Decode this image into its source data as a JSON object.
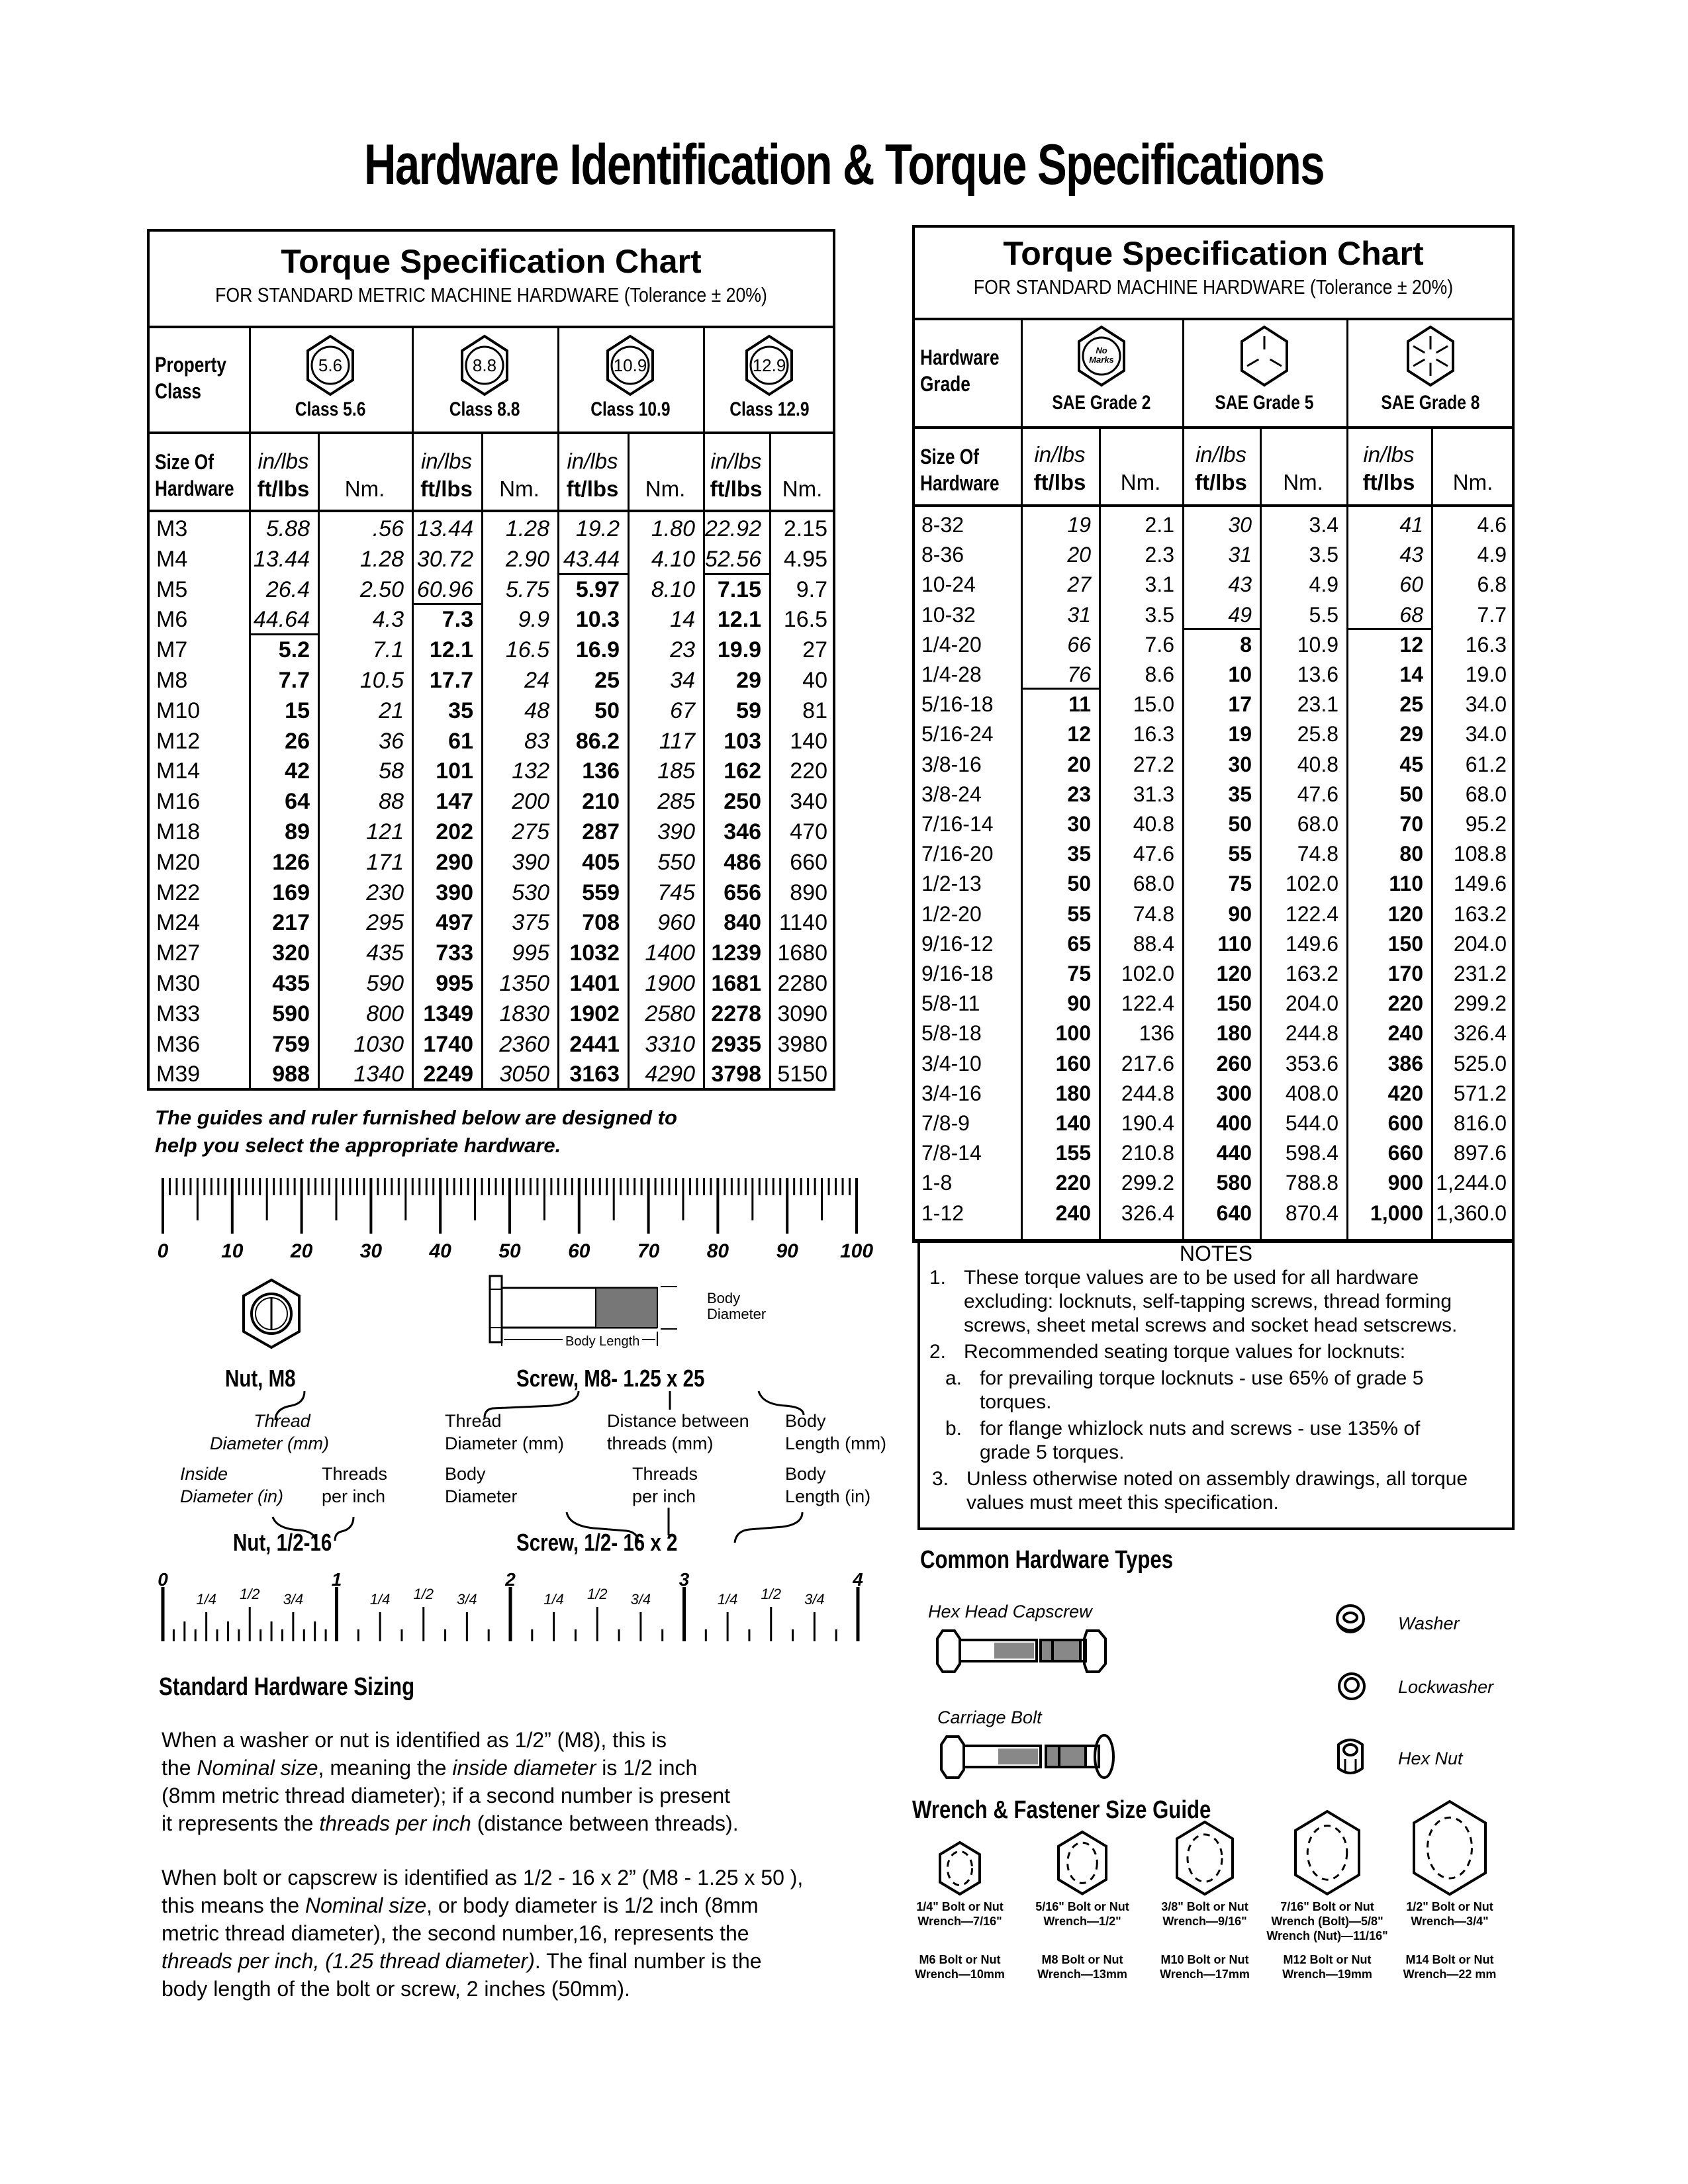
{
  "page_title": "Hardware Identification  &  Torque Specifications",
  "metric_chart": {
    "title": "Torque Specification Chart",
    "subtitle": "FOR STANDARD METRIC MACHINE HARDWARE (Tolerance ± 20%)",
    "property_class_label_1": "Property",
    "property_class_label_2": "Class",
    "classes": [
      {
        "mark": "5.6",
        "label": "Class 5.6"
      },
      {
        "mark": "8.8",
        "label": "Class 8.8"
      },
      {
        "mark": "10.9",
        "label": "Class 10.9"
      },
      {
        "mark": "12.9",
        "label": "Class 12.9"
      }
    ],
    "size_label_1": "Size Of",
    "size_label_2": "Hardware",
    "unit_top": "in/lbs",
    "unit_bottom": "ft/lbs",
    "unit_nm": "Nm.",
    "rows": [
      {
        "size": "M3",
        "v": [
          "5.88",
          ".56",
          "13.44",
          "1.28",
          "19.2",
          "1.80",
          "22.92",
          "2.15"
        ]
      },
      {
        "size": "M4",
        "v": [
          "13.44",
          "1.28",
          "30.72",
          "2.90",
          "43.44",
          "4.10",
          "52.56",
          "4.95"
        ]
      },
      {
        "size": "M5",
        "v": [
          "26.4",
          "2.50",
          "60.96",
          "5.75",
          "5.97",
          "8.10",
          "7.15",
          "9.7"
        ]
      },
      {
        "size": "M6",
        "v": [
          "44.64",
          "4.3",
          "7.3",
          "9.9",
          "10.3",
          "14",
          "12.1",
          "16.5"
        ]
      },
      {
        "size": "M7",
        "v": [
          "5.2",
          "7.1",
          "12.1",
          "16.5",
          "16.9",
          "23",
          "19.9",
          "27"
        ]
      },
      {
        "size": "M8",
        "v": [
          "7.7",
          "10.5",
          "17.7",
          "24",
          "25",
          "34",
          "29",
          "40"
        ]
      },
      {
        "size": "M10",
        "v": [
          "15",
          "21",
          "35",
          "48",
          "50",
          "67",
          "59",
          "81"
        ]
      },
      {
        "size": "M12",
        "v": [
          "26",
          "36",
          "61",
          "83",
          "86.2",
          "117",
          "103",
          "140"
        ]
      },
      {
        "size": "M14",
        "v": [
          "42",
          "58",
          "101",
          "132",
          "136",
          "185",
          "162",
          "220"
        ]
      },
      {
        "size": "M16",
        "v": [
          "64",
          "88",
          "147",
          "200",
          "210",
          "285",
          "250",
          "340"
        ]
      },
      {
        "size": "M18",
        "v": [
          "89",
          "121",
          "202",
          "275",
          "287",
          "390",
          "346",
          "470"
        ]
      },
      {
        "size": "M20",
        "v": [
          "126",
          "171",
          "290",
          "390",
          "405",
          "550",
          "486",
          "660"
        ]
      },
      {
        "size": "M22",
        "v": [
          "169",
          "230",
          "390",
          "530",
          "559",
          "745",
          "656",
          "890"
        ]
      },
      {
        "size": "M24",
        "v": [
          "217",
          "295",
          "497",
          "375",
          "708",
          "960",
          "840",
          "1140"
        ]
      },
      {
        "size": "M27",
        "v": [
          "320",
          "435",
          "733",
          "995",
          "1032",
          "1400",
          "1239",
          "1680"
        ]
      },
      {
        "size": "M30",
        "v": [
          "435",
          "590",
          "995",
          "1350",
          "1401",
          "1900",
          "1681",
          "2280"
        ]
      },
      {
        "size": "M33",
        "v": [
          "590",
          "800",
          "1349",
          "1830",
          "1902",
          "2580",
          "2278",
          "3090"
        ]
      },
      {
        "size": "M36",
        "v": [
          "759",
          "1030",
          "1740",
          "2360",
          "2441",
          "3310",
          "2935",
          "3980"
        ]
      },
      {
        "size": "M39",
        "v": [
          "988",
          "1340",
          "2249",
          "3050",
          "3163",
          "4290",
          "3798",
          "5150"
        ]
      }
    ],
    "inlbs_rows_through": [
      3,
      2,
      1,
      1
    ]
  },
  "guide_note_1": "The guides and ruler furnished below are designed to",
  "guide_note_2": "help you select the appropriate hardware.",
  "mm_ruler": {
    "labels": [
      "0",
      "10",
      "20",
      "30",
      "40",
      "50",
      "60",
      "70",
      "80",
      "90",
      "100"
    ],
    "unit": "mm",
    "max": 100
  },
  "metric_nut": {
    "name": "Nut, M8",
    "thread_label_1": "Thread",
    "thread_label_2": "Diameter (mm)"
  },
  "metric_screw": {
    "name": "Screw, M8- 1.25 x 25",
    "body_diameter_1": "Body",
    "body_diameter_2": "Diameter",
    "body_length": "Body Length",
    "lbl_thread_1": "Thread",
    "lbl_thread_2": "Diameter (mm)",
    "lbl_dist_1": "Distance between",
    "lbl_dist_2": "threads (mm)",
    "lbl_len_1": "Body",
    "lbl_len_2": "Length (mm)"
  },
  "inch_nut": {
    "name": "Nut, 1/2-16",
    "lbl_inside_1": "Inside",
    "lbl_inside_2": "Diameter (in)",
    "lbl_threads_1": "Threads",
    "lbl_threads_2": "per inch"
  },
  "inch_screw": {
    "name": "Screw, 1/2- 16 x 2",
    "lbl_body_1": "Body",
    "lbl_body_2": "Diameter",
    "lbl_threads_1": "Threads",
    "lbl_threads_2": "per inch",
    "lbl_len_1": "Body",
    "lbl_len_2": "Length (in)"
  },
  "inch_ruler": {
    "whole_labels": [
      "0",
      "1",
      "2",
      "3",
      "4"
    ],
    "fraction_labels": [
      "1/4",
      "1/2",
      "3/4"
    ],
    "unit": "in",
    "max": 4
  },
  "sizing": {
    "title": "Standard Hardware Sizing",
    "p1": [
      {
        "t": "When a washer or nut is identified as 1/2” (M8), this is"
      },
      {
        "t": "the ",
        "i": "Nominal size",
        "t2": ", meaning the ",
        "i2": "inside diameter",
        "t3": " is 1/2 inch"
      },
      {
        "t": "(8mm metric thread diameter); if a second number is present"
      },
      {
        "t": "it represents the ",
        "i": "threads per inch",
        "t2": " (distance between threads)."
      }
    ],
    "p2": [
      {
        "t": "When bolt or capscrew is identified as 1/2 - 16 x 2” (M8 - 1.25 x 50 ),"
      },
      {
        "t": "this means the ",
        "i": "Nominal size",
        "t2": ", or body diameter is 1/2 inch (8mm"
      },
      {
        "t": "metric thread diameter), the second number,16, represents the"
      },
      {
        "i": "threads per inch, (1.25 thread diameter)",
        "t2": ". The final number is the"
      },
      {
        "t": "body length of the bolt or screw, 2 inches (50mm)."
      }
    ]
  },
  "sae_chart": {
    "title": "Torque Specification Chart",
    "subtitle": "FOR STANDARD MACHINE HARDWARE (Tolerance ± 20%)",
    "grade_label_1": "Hardware",
    "grade_label_2": "Grade",
    "grades": [
      {
        "mark": "No Marks",
        "label": "SAE Grade 2"
      },
      {
        "mark": "3 radial lines",
        "label": "SAE Grade 5"
      },
      {
        "mark": "6 radial lines",
        "label": "SAE Grade 8"
      }
    ],
    "size_label_1": "Size Of",
    "size_label_2": "Hardware",
    "unit_top": "in/lbs",
    "unit_bottom": "ft/lbs",
    "unit_nm": "Nm.",
    "rows": [
      {
        "size": "8-32",
        "v": [
          "19",
          "2.1",
          "30",
          "3.4",
          "41",
          "4.6"
        ]
      },
      {
        "size": "8-36",
        "v": [
          "20",
          "2.3",
          "31",
          "3.5",
          "43",
          "4.9"
        ]
      },
      {
        "size": "10-24",
        "v": [
          "27",
          "3.1",
          "43",
          "4.9",
          "60",
          "6.8"
        ]
      },
      {
        "size": "10-32",
        "v": [
          "31",
          "3.5",
          "49",
          "5.5",
          "68",
          "7.7"
        ]
      },
      {
        "size": "1/4-20",
        "v": [
          "66",
          "7.6",
          "8",
          "10.9",
          "12",
          "16.3"
        ]
      },
      {
        "size": "1/4-28",
        "v": [
          "76",
          "8.6",
          "10",
          "13.6",
          "14",
          "19.0"
        ]
      },
      {
        "size": "5/16-18",
        "v": [
          "11",
          "15.0",
          "17",
          "23.1",
          "25",
          "34.0"
        ]
      },
      {
        "size": "5/16-24",
        "v": [
          "12",
          "16.3",
          "19",
          "25.8",
          "29",
          "34.0"
        ]
      },
      {
        "size": "3/8-16",
        "v": [
          "20",
          "27.2",
          "30",
          "40.8",
          "45",
          "61.2"
        ]
      },
      {
        "size": "3/8-24",
        "v": [
          "23",
          "31.3",
          "35",
          "47.6",
          "50",
          "68.0"
        ]
      },
      {
        "size": "7/16-14",
        "v": [
          "30",
          "40.8",
          "50",
          "68.0",
          "70",
          "95.2"
        ]
      },
      {
        "size": "7/16-20",
        "v": [
          "35",
          "47.6",
          "55",
          "74.8",
          "80",
          "108.8"
        ]
      },
      {
        "size": "1/2-13",
        "v": [
          "50",
          "68.0",
          "75",
          "102.0",
          "110",
          "149.6"
        ]
      },
      {
        "size": "1/2-20",
        "v": [
          "55",
          "74.8",
          "90",
          "122.4",
          "120",
          "163.2"
        ]
      },
      {
        "size": "9/16-12",
        "v": [
          "65",
          "88.4",
          "110",
          "149.6",
          "150",
          "204.0"
        ]
      },
      {
        "size": "9/16-18",
        "v": [
          "75",
          "102.0",
          "120",
          "163.2",
          "170",
          "231.2"
        ]
      },
      {
        "size": "5/8-11",
        "v": [
          "90",
          "122.4",
          "150",
          "204.0",
          "220",
          "299.2"
        ]
      },
      {
        "size": "5/8-18",
        "v": [
          "100",
          "136",
          "180",
          "244.8",
          "240",
          "326.4"
        ]
      },
      {
        "size": "3/4-10",
        "v": [
          "160",
          "217.6",
          "260",
          "353.6",
          "386",
          "525.0"
        ]
      },
      {
        "size": "3/4-16",
        "v": [
          "180",
          "244.8",
          "300",
          "408.0",
          "420",
          "571.2"
        ]
      },
      {
        "size": "7/8-9",
        "v": [
          "140",
          "190.4",
          "400",
          "544.0",
          "600",
          "816.0"
        ]
      },
      {
        "size": "7/8-14",
        "v": [
          "155",
          "210.8",
          "440",
          "598.4",
          "660",
          "897.6"
        ]
      },
      {
        "size": "1-8",
        "v": [
          "220",
          "299.2",
          "580",
          "788.8",
          "900",
          "1,244.0"
        ]
      },
      {
        "size": "1-12",
        "v": [
          "240",
          "326.4",
          "640",
          "870.4",
          "1,000",
          "1,360.0"
        ]
      }
    ],
    "inlbs_rows_through": [
      5,
      3,
      3
    ]
  },
  "notes": {
    "title": "NOTES",
    "items": [
      {
        "num": "1.",
        "lines": [
          "These torque values are to be used for all hardware",
          "excluding: locknuts, self-tapping screws, thread forming",
          "screws, sheet metal screws and socket head setscrews."
        ]
      },
      {
        "num": "2.",
        "lines": [
          "Recommended seating torque values for locknuts:"
        ]
      },
      {
        "num": "a.",
        "lines": [
          "for prevailing torque locknuts - use 65% of grade 5",
          "torques."
        ]
      },
      {
        "num": "b.",
        "lines": [
          "for flange whizlock nuts and screws - use 135% of",
          "grade 5 torques."
        ]
      },
      {
        "num": "3.",
        "lines": [
          "Unless otherwise noted on assembly drawings, all torque",
          "values must meet this specification."
        ]
      }
    ]
  },
  "hardware_types": {
    "title": "Common Hardware Types",
    "items": [
      "Hex Head Capscrew",
      "Carriage Bolt",
      "Washer",
      "Lockwasher",
      "Hex Nut"
    ]
  },
  "wrench_guide": {
    "title": "Wrench & Fastener Size Guide",
    "items": [
      {
        "inch_1": "1/4\" Bolt or Nut",
        "inch_2": "Wrench—7/16\"",
        "inch_3": "",
        "metric_1": "M6 Bolt or Nut",
        "metric_2": "Wrench—10mm"
      },
      {
        "inch_1": "5/16\" Bolt or Nut",
        "inch_2": "Wrench—1/2\"",
        "inch_3": "",
        "metric_1": "M8 Bolt or Nut",
        "metric_2": "Wrench—13mm"
      },
      {
        "inch_1": "3/8\" Bolt or Nut",
        "inch_2": "Wrench—9/16\"",
        "inch_3": "",
        "metric_1": "M10 Bolt or Nut",
        "metric_2": "Wrench—17mm"
      },
      {
        "inch_1": "7/16\" Bolt or Nut",
        "inch_2": "Wrench (Bolt)—5/8\"",
        "inch_3": "Wrench (Nut)—11/16\"",
        "metric_1": "M12 Bolt or Nut",
        "metric_2": "Wrench—19mm"
      },
      {
        "inch_1": "1/2\" Bolt or Nut",
        "inch_2": "Wrench—3/4\"",
        "inch_3": "",
        "metric_1": "M14 Bolt or Nut",
        "metric_2": "Wrench—22 mm"
      }
    ]
  }
}
